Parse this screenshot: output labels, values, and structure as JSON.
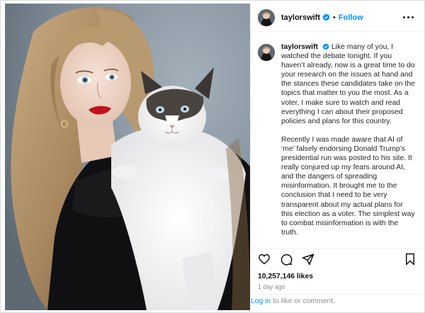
{
  "post": {
    "username": "taylorswift",
    "follow_label": "Follow",
    "separator": "•",
    "caption_paragraphs": [
      "Like many of you, I watched the debate tonight. If you haven’t already, now is a great time to do your research on the issues at hand and the stances these candidates take on the topics that matter to you the most. As a voter, I make sure to watch and read everything I can about their proposed policies and plans for this country.",
      "Recently I was made aware that AI of ‘me’ falsely endorsing Donald Trump’s presidential run was posted to his site. It really conjured up my fears around AI, and the dangers of spreading misinformation. It brought me to the conclusion that I need to be very transparent about my actual plans for this election as a voter. The simplest way to combat misinformation is with the truth."
    ],
    "likes": "10,257,146 likes",
    "time_ago": "1 day ago",
    "login_link": "Log in",
    "login_suffix": " to like or comment."
  },
  "icons": {
    "verified": "verified-badge-icon",
    "more": "more-options-icon",
    "like": "heart-icon",
    "comment": "comment-icon",
    "share": "share-icon",
    "save": "bookmark-icon"
  },
  "colors": {
    "accent": "#0095f6",
    "text": "#111111",
    "muted": "#8e8e8e",
    "border": "#dbdbdb",
    "photo_backdrop": "#7d8b96"
  }
}
